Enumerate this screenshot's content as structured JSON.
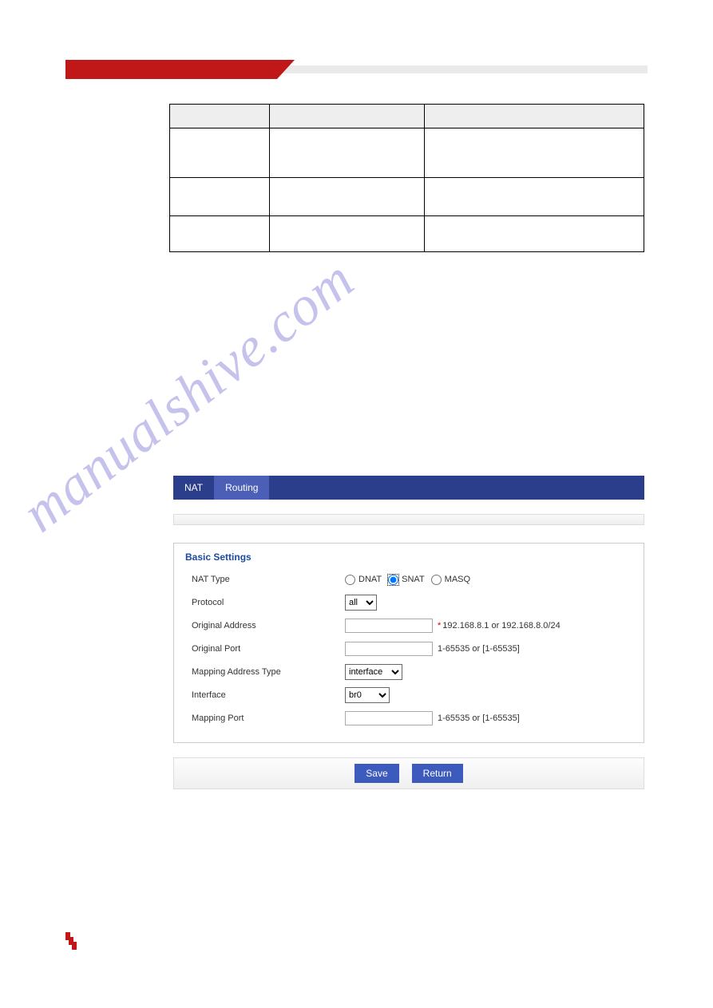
{
  "watermark_text": "manualshive.com",
  "table": {
    "headers": [
      "",
      "",
      ""
    ],
    "rows": [
      [
        "",
        "",
        ""
      ],
      [
        "",
        "",
        ""
      ],
      [
        "",
        "",
        ""
      ]
    ]
  },
  "tabs": {
    "left": "NAT",
    "right": "Routing"
  },
  "fieldset_title": "Basic Settings",
  "labels": {
    "nat_type": "NAT Type",
    "protocol": "Protocol",
    "orig_addr": "Original Address",
    "orig_port": "Original Port",
    "map_addr_type": "Mapping Address Type",
    "interface": "Interface",
    "map_port": "Mapping Port"
  },
  "radios": {
    "dnat": "DNAT",
    "snat": "SNAT",
    "masq": "MASQ"
  },
  "selects": {
    "protocol": "all",
    "map_addr_type": "interface",
    "interface": "br0"
  },
  "hints": {
    "orig_addr": "192.168.8.1 or 192.168.8.0/24",
    "orig_port": "1-65535 or [1-65535]",
    "map_port": "1-65535 or [1-65535]"
  },
  "buttons": {
    "save": "Save",
    "return": "Return"
  }
}
